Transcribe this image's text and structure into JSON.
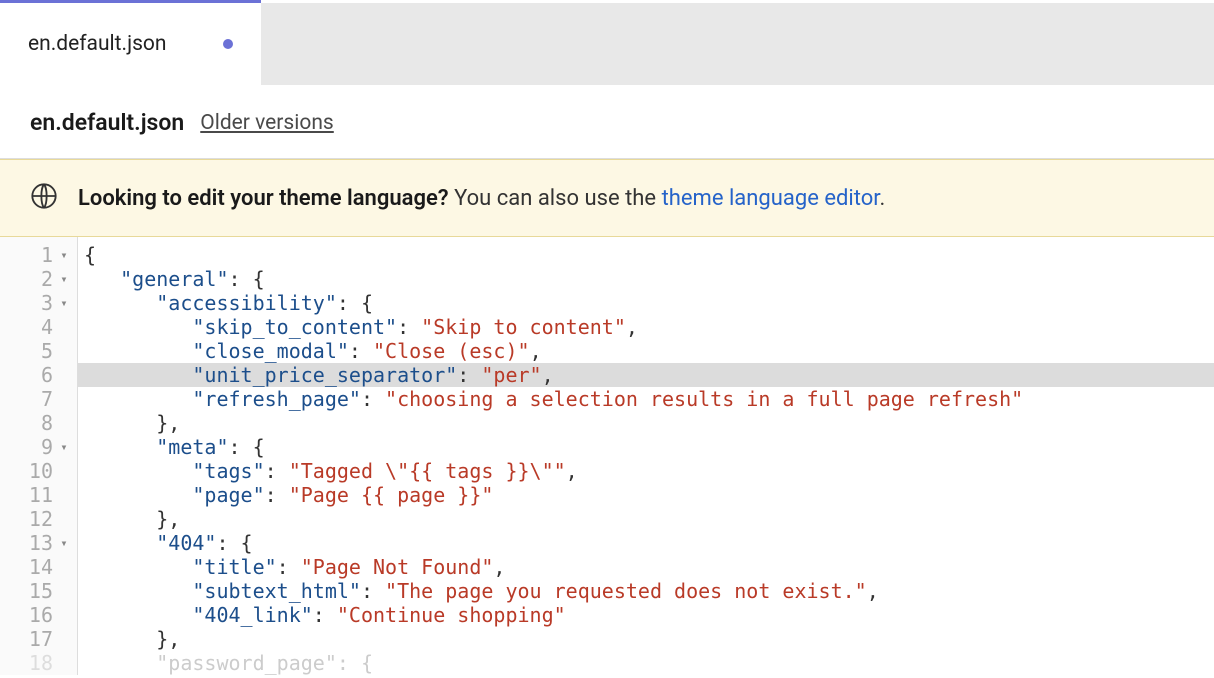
{
  "tab": {
    "title": "en.default.json",
    "dirty": true
  },
  "breadcrumb": {
    "title": "en.default.json",
    "older_versions": "Older versions"
  },
  "banner": {
    "strong": "Looking to edit your theme language?",
    "rest": " You can also use the ",
    "link": "theme language editor",
    "period": "."
  },
  "code": {
    "lines": [
      {
        "n": 1,
        "fold": true,
        "hl": false,
        "indent": 0,
        "segments": [
          {
            "t": "{",
            "c": "punc"
          }
        ]
      },
      {
        "n": 2,
        "fold": true,
        "hl": false,
        "indent": 1,
        "segments": [
          {
            "t": "\"general\"",
            "c": "key"
          },
          {
            "t": ": {",
            "c": "punc"
          }
        ]
      },
      {
        "n": 3,
        "fold": true,
        "hl": false,
        "indent": 2,
        "segments": [
          {
            "t": "\"accessibility\"",
            "c": "key"
          },
          {
            "t": ": {",
            "c": "punc"
          }
        ]
      },
      {
        "n": 4,
        "fold": false,
        "hl": false,
        "indent": 3,
        "segments": [
          {
            "t": "\"skip_to_content\"",
            "c": "key"
          },
          {
            "t": ": ",
            "c": "punc"
          },
          {
            "t": "\"Skip to content\"",
            "c": "str"
          },
          {
            "t": ",",
            "c": "punc"
          }
        ]
      },
      {
        "n": 5,
        "fold": false,
        "hl": false,
        "indent": 3,
        "segments": [
          {
            "t": "\"close_modal\"",
            "c": "key"
          },
          {
            "t": ": ",
            "c": "punc"
          },
          {
            "t": "\"Close (esc)\"",
            "c": "str"
          },
          {
            "t": ",",
            "c": "punc"
          }
        ]
      },
      {
        "n": 6,
        "fold": false,
        "hl": true,
        "indent": 3,
        "segments": [
          {
            "t": "\"unit_price_separator\"",
            "c": "key"
          },
          {
            "t": ": ",
            "c": "punc"
          },
          {
            "t": "\"per\"",
            "c": "str"
          },
          {
            "t": ",",
            "c": "punc"
          }
        ]
      },
      {
        "n": 7,
        "fold": false,
        "hl": false,
        "indent": 3,
        "segments": [
          {
            "t": "\"refresh_page\"",
            "c": "key"
          },
          {
            "t": ": ",
            "c": "punc"
          },
          {
            "t": "\"choosing a selection results in a full page refresh\"",
            "c": "str"
          }
        ]
      },
      {
        "n": 8,
        "fold": false,
        "hl": false,
        "indent": 2,
        "segments": [
          {
            "t": "},",
            "c": "punc"
          }
        ]
      },
      {
        "n": 9,
        "fold": true,
        "hl": false,
        "indent": 2,
        "segments": [
          {
            "t": "\"meta\"",
            "c": "key"
          },
          {
            "t": ": {",
            "c": "punc"
          }
        ]
      },
      {
        "n": 10,
        "fold": false,
        "hl": false,
        "indent": 3,
        "segments": [
          {
            "t": "\"tags\"",
            "c": "key"
          },
          {
            "t": ": ",
            "c": "punc"
          },
          {
            "t": "\"Tagged \\\"{{ tags }}\\\"\"",
            "c": "str"
          },
          {
            "t": ",",
            "c": "punc"
          }
        ]
      },
      {
        "n": 11,
        "fold": false,
        "hl": false,
        "indent": 3,
        "segments": [
          {
            "t": "\"page\"",
            "c": "key"
          },
          {
            "t": ": ",
            "c": "punc"
          },
          {
            "t": "\"Page {{ page }}\"",
            "c": "str"
          }
        ]
      },
      {
        "n": 12,
        "fold": false,
        "hl": false,
        "indent": 2,
        "segments": [
          {
            "t": "},",
            "c": "punc"
          }
        ]
      },
      {
        "n": 13,
        "fold": true,
        "hl": false,
        "indent": 2,
        "segments": [
          {
            "t": "\"404\"",
            "c": "key"
          },
          {
            "t": ": {",
            "c": "punc"
          }
        ]
      },
      {
        "n": 14,
        "fold": false,
        "hl": false,
        "indent": 3,
        "segments": [
          {
            "t": "\"title\"",
            "c": "key"
          },
          {
            "t": ": ",
            "c": "punc"
          },
          {
            "t": "\"Page Not Found\"",
            "c": "str"
          },
          {
            "t": ",",
            "c": "punc"
          }
        ]
      },
      {
        "n": 15,
        "fold": false,
        "hl": false,
        "indent": 3,
        "segments": [
          {
            "t": "\"subtext_html\"",
            "c": "key"
          },
          {
            "t": ": ",
            "c": "punc"
          },
          {
            "t": "\"The page you requested does not exist.\"",
            "c": "str"
          },
          {
            "t": ",",
            "c": "punc"
          }
        ]
      },
      {
        "n": 16,
        "fold": false,
        "hl": false,
        "indent": 3,
        "segments": [
          {
            "t": "\"404_link\"",
            "c": "key"
          },
          {
            "t": ": ",
            "c": "punc"
          },
          {
            "t": "\"Continue shopping\"",
            "c": "str"
          }
        ]
      },
      {
        "n": 17,
        "fold": false,
        "hl": false,
        "indent": 2,
        "segments": [
          {
            "t": "},",
            "c": "punc"
          }
        ]
      },
      {
        "n": 18,
        "fold": false,
        "hl": false,
        "indent": 2,
        "fade": true,
        "segments": [
          {
            "t": "\"password_page\"",
            "c": "key"
          },
          {
            "t": ": {",
            "c": "punc"
          }
        ]
      }
    ]
  }
}
